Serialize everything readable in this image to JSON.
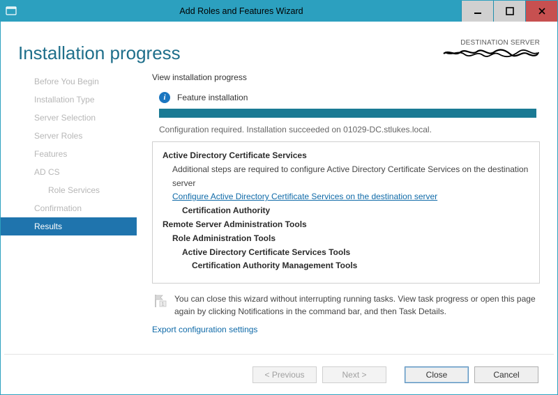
{
  "window": {
    "title": "Add Roles and Features Wizard"
  },
  "header": {
    "page_title": "Installation progress",
    "dest_label": "DESTINATION SERVER"
  },
  "sidebar": {
    "items": [
      {
        "label": "Before You Begin"
      },
      {
        "label": "Installation Type"
      },
      {
        "label": "Server Selection"
      },
      {
        "label": "Server Roles"
      },
      {
        "label": "Features"
      },
      {
        "label": "AD CS"
      },
      {
        "label": "Role Services"
      },
      {
        "label": "Confirmation"
      },
      {
        "label": "Results"
      }
    ]
  },
  "main": {
    "subheading": "View installation progress",
    "feature_label": "Feature installation",
    "status_line": "Configuration required. Installation succeeded on 01029-DC.stlukes.local.",
    "details": {
      "adcs_heading": "Active Directory Certificate Services",
      "adcs_desc": "Additional steps are required to configure Active Directory Certificate Services on the destination server",
      "adcs_link": "Configure Active Directory Certificate Services on the destination server",
      "ca_label": "Certification Authority",
      "rsat_heading": "Remote Server Administration Tools",
      "rat_label": "Role Administration Tools",
      "adcs_tools": "Active Directory Certificate Services Tools",
      "camt_label": "Certification Authority Management Tools"
    },
    "note_text": "You can close this wizard without interrupting running tasks. View task progress or open this page again by clicking Notifications in the command bar, and then Task Details.",
    "export_label": "Export configuration settings"
  },
  "footer": {
    "previous": "< Previous",
    "next": "Next >",
    "close": "Close",
    "cancel": "Cancel"
  }
}
